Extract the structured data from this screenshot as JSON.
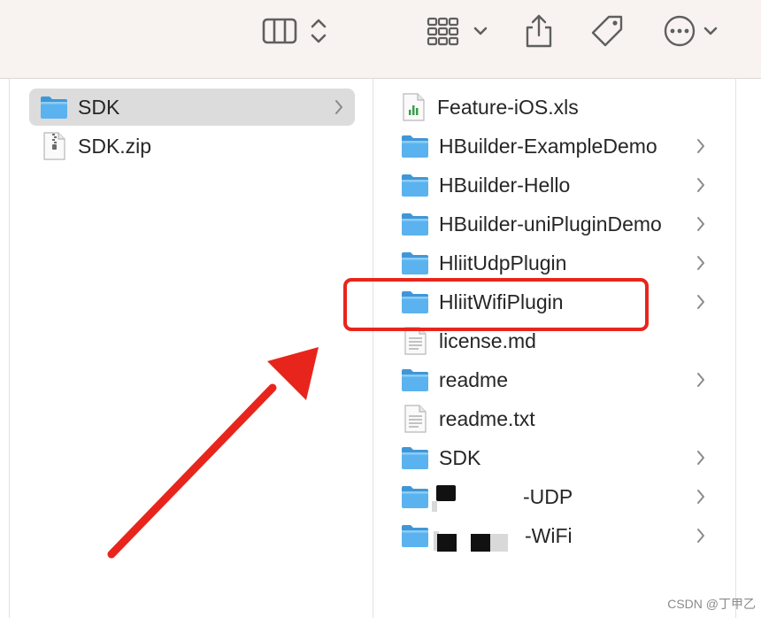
{
  "toolbar": {
    "icons": [
      "column-view-icon",
      "sort-updown-icon",
      "grid-group-icon",
      "chevron-down-icon",
      "share-icon",
      "tag-icon",
      "more-icon",
      "chevron-down-icon"
    ]
  },
  "left_column": {
    "items": [
      {
        "label": "SDK",
        "icon": "folder-icon",
        "selected": true,
        "has_children": true
      },
      {
        "label": "SDK.zip",
        "icon": "zip-file-icon",
        "selected": false,
        "has_children": false
      }
    ]
  },
  "right_column": {
    "items": [
      {
        "label": "Feature-iOS.xls",
        "icon": "spreadsheet-icon",
        "has_children": false
      },
      {
        "label": "HBuilder-ExampleDemo",
        "icon": "folder-icon",
        "has_children": true
      },
      {
        "label": "HBuilder-Hello",
        "icon": "folder-icon",
        "has_children": true
      },
      {
        "label": "HBuilder-uniPluginDemo",
        "icon": "folder-icon",
        "has_children": true
      },
      {
        "label": "HliitUdpPlugin",
        "icon": "folder-icon",
        "has_children": true
      },
      {
        "label": "HliitWifiPlugin",
        "icon": "folder-icon",
        "has_children": true,
        "highlighted": true
      },
      {
        "label": "license.md",
        "icon": "text-file-icon",
        "has_children": false
      },
      {
        "label": "readme",
        "icon": "folder-icon",
        "has_children": true
      },
      {
        "label": "readme.txt",
        "icon": "text-file-icon",
        "has_children": false
      },
      {
        "label": "SDK",
        "icon": "folder-icon",
        "has_children": true
      },
      {
        "label": "-UDP",
        "icon": "folder-icon",
        "has_children": true,
        "redacted": true
      },
      {
        "label": "-WiFi",
        "icon": "folder-icon",
        "has_children": true,
        "redacted": true
      }
    ]
  },
  "annotation": {
    "highlight_color": "#e8251c",
    "arrow_color": "#e8251c"
  },
  "watermark": "CSDN @丁甲乙",
  "colors": {
    "toolbar_bg": "#f8f3f0",
    "selection_bg": "#dcdcdc",
    "folder_blue": "#5ab3ef"
  }
}
